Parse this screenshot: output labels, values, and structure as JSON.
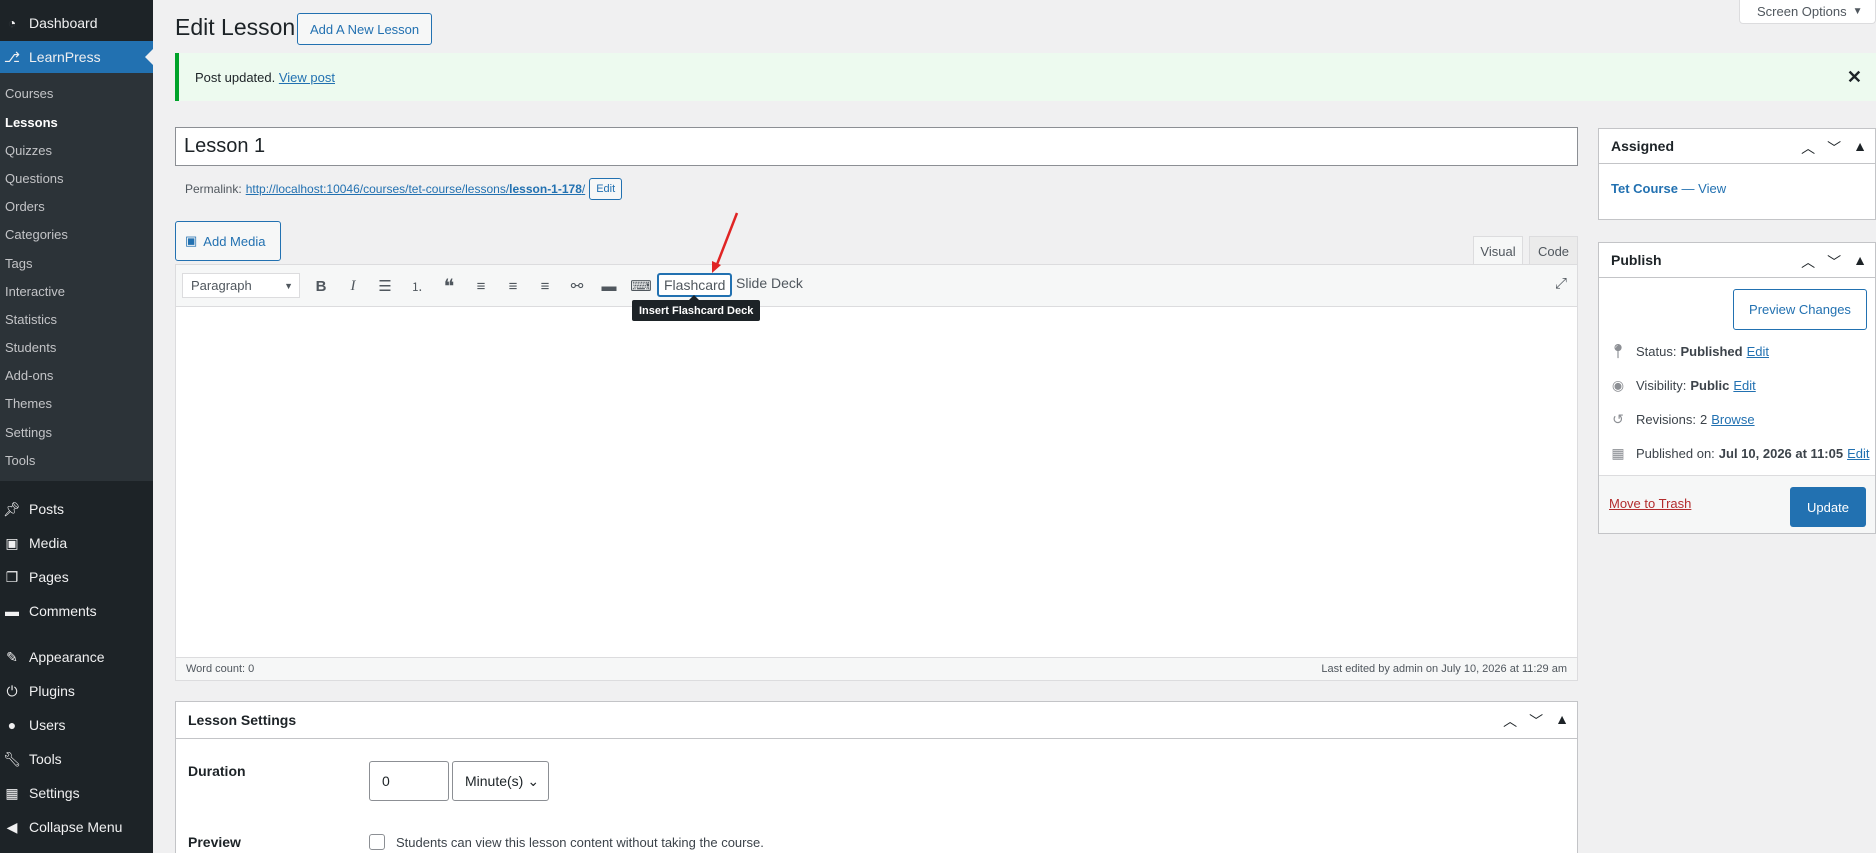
{
  "sidebar": {
    "top_items": [
      {
        "label": "Dashboard",
        "icon": "dashboard-icon"
      },
      {
        "label": "LearnPress",
        "icon": "learnpress-icon"
      }
    ],
    "learnpress_submenu": [
      "Courses",
      "Lessons",
      "Quizzes",
      "Questions",
      "Orders",
      "Categories",
      "Tags",
      "Interactive",
      "Statistics",
      "Students",
      "Add-ons",
      "Themes",
      "Settings",
      "Tools"
    ],
    "bottom_items": [
      {
        "label": "Posts",
        "icon": "pin-icon"
      },
      {
        "label": "Media",
        "icon": "media-icon"
      },
      {
        "label": "Pages",
        "icon": "pages-icon"
      },
      {
        "label": "Comments",
        "icon": "comment-icon"
      },
      {
        "label": "Appearance",
        "icon": "brush-icon"
      },
      {
        "label": "Plugins",
        "icon": "plug-icon"
      },
      {
        "label": "Users",
        "icon": "user-icon"
      },
      {
        "label": "Tools",
        "icon": "wrench-icon"
      },
      {
        "label": "Settings",
        "icon": "settings-icon"
      },
      {
        "label": "Collapse Menu",
        "icon": "collapse-icon"
      }
    ]
  },
  "header": {
    "title": "Edit Lesson",
    "add_new": "Add A New Lesson",
    "screen_options": "Screen Options"
  },
  "notice": {
    "text": "Post updated.",
    "link": "View post"
  },
  "post": {
    "title": "Lesson 1",
    "permalink_label": "Permalink:",
    "permalink_url_prefix": "http://localhost:10046/courses/tet-course/lessons/",
    "permalink_slug": "lesson-1-178",
    "permalink_suffix": "/",
    "permalink_edit": "Edit"
  },
  "editor": {
    "add_media": "Add Media",
    "tab_visual": "Visual",
    "tab_code": "Code",
    "format": "Paragraph",
    "flashcard": "Flashcard",
    "slide_deck": "Slide Deck",
    "tooltip": "Insert Flashcard Deck",
    "word_count": "Word count: 0",
    "last_edited": "Last edited by admin on July 10, 2026 at 11:29 am"
  },
  "lesson_settings": {
    "title": "Lesson Settings",
    "duration_label": "Duration",
    "duration_value": "0",
    "duration_unit": "Minute(s)",
    "preview_label": "Preview",
    "preview_text": "Students can view this lesson content without taking the course."
  },
  "assigned": {
    "title": "Assigned",
    "course": "Tet Course",
    "sep": " — ",
    "view": "View"
  },
  "publish": {
    "title": "Publish",
    "preview_changes": "Preview Changes",
    "status_label": "Status:",
    "status_value": "Published",
    "visibility_label": "Visibility:",
    "visibility_value": "Public",
    "revisions_label": "Revisions:",
    "revisions_value": "2",
    "browse": "Browse",
    "published_label": "Published on:",
    "published_value": "Jul 10, 2026 at 11:05",
    "edit": "Edit",
    "trash": "Move to Trash",
    "update": "Update"
  },
  "colors": {
    "accent": "#2271b1",
    "sidebar_bg": "#1d2327",
    "annotation": "#e02424"
  }
}
